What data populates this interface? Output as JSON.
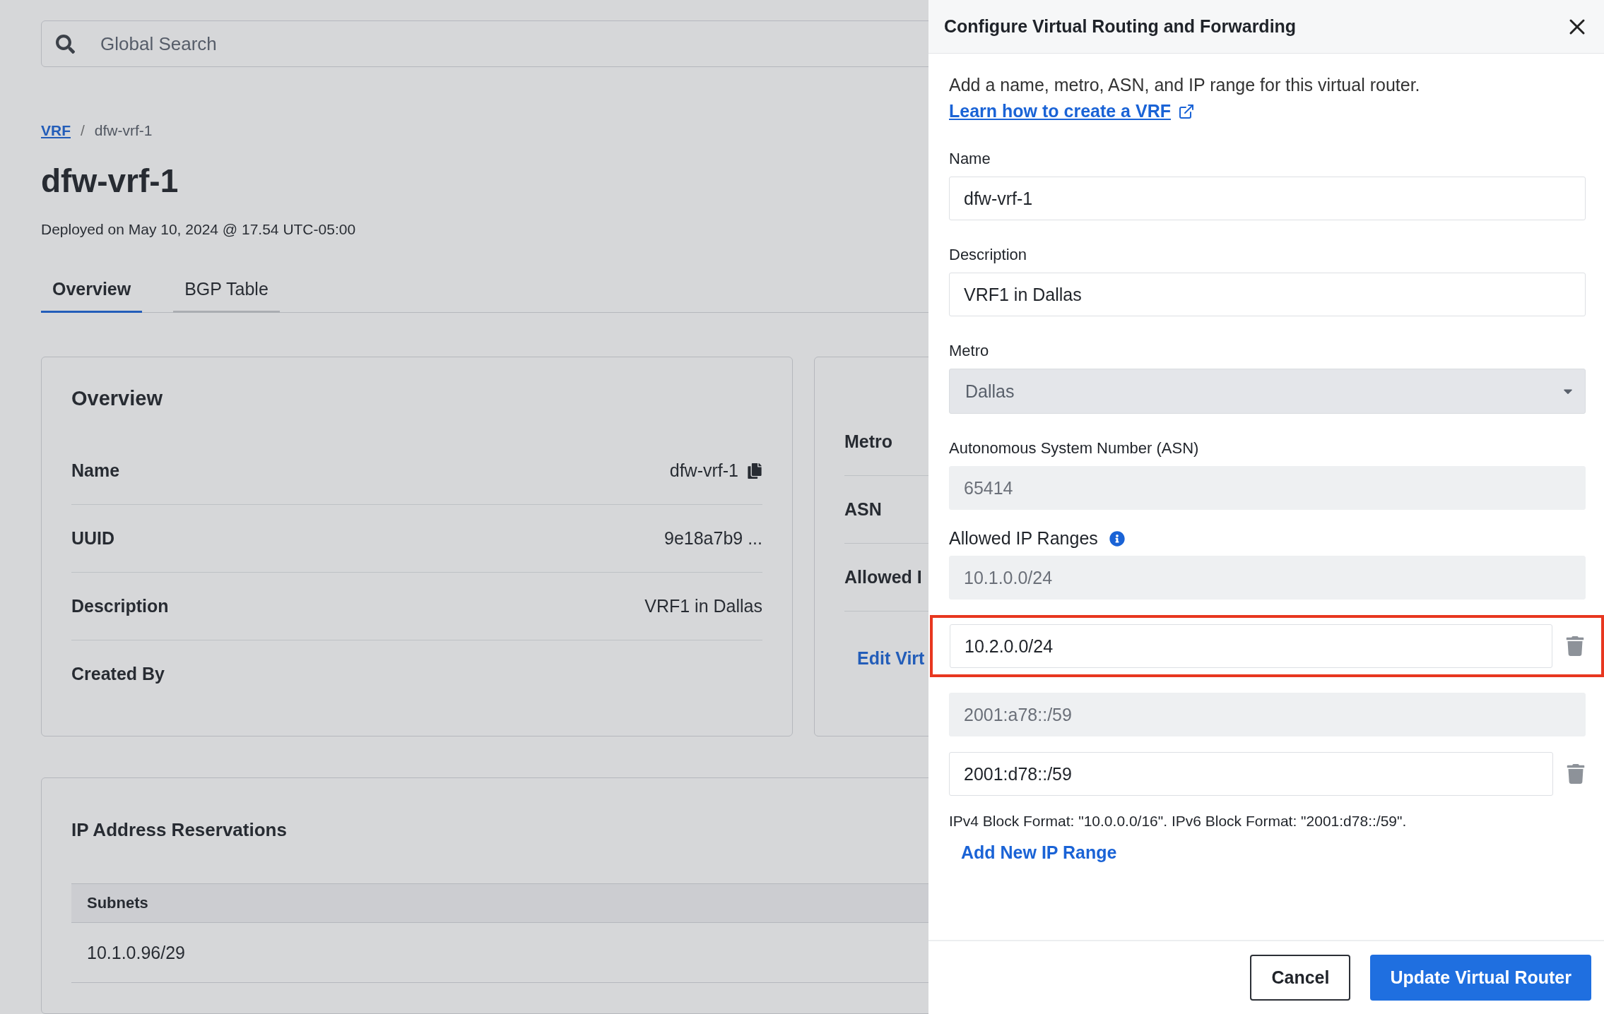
{
  "search": {
    "placeholder": "Global Search"
  },
  "breadcrumb": {
    "items": [
      {
        "label": "VRF",
        "kind": "link"
      },
      {
        "label": "dfw-vrf-1",
        "kind": "current"
      }
    ],
    "separator": "/"
  },
  "page": {
    "title": "dfw-vrf-1",
    "subtitle": "Deployed on May 10, 2024 @ 17.54 UTC-05:00"
  },
  "tabs": [
    {
      "label": "Overview",
      "selected": true
    },
    {
      "label": "BGP Table",
      "selected": false
    }
  ],
  "overview_card": {
    "title": "Overview",
    "rows": [
      {
        "label": "Name",
        "value": "dfw-vrf-1",
        "copy": true
      },
      {
        "label": "UUID",
        "value": "9e18a7b9 ...",
        "copy": false
      },
      {
        "label": "Description",
        "value": "VRF1 in Dallas",
        "copy": false
      },
      {
        "label": "Created By",
        "copy": false
      }
    ]
  },
  "side_card": {
    "rows": [
      "Metro",
      "ASN",
      "Allowed I"
    ],
    "link": "Edit Virt"
  },
  "reservations": {
    "title": "IP Address Reservations",
    "columns": [
      "Subnets"
    ],
    "rows": [
      [
        "10.1.0.96/29"
      ]
    ]
  },
  "drawer": {
    "title": "Configure Virtual Routing and Forwarding",
    "intro": "Add a name, metro, ASN, and IP range for this virtual router.",
    "learn_link": "Learn how to create a VRF",
    "fields": [
      {
        "kind": "text",
        "label": "Name",
        "value": "dfw-vrf-1",
        "disabled": false
      },
      {
        "kind": "text",
        "label": "Description",
        "value": "VRF1 in Dallas",
        "disabled": false
      },
      {
        "kind": "select",
        "label": "Metro",
        "value": "Dallas",
        "disabled": true
      },
      {
        "kind": "text",
        "label": "Autonomous System Number (ASN)",
        "value": "65414",
        "disabled": true
      }
    ],
    "ranges_label": "Allowed IP Ranges",
    "ranges": [
      {
        "value": "10.1.0.0/24",
        "editable": false,
        "highlighted": false
      },
      {
        "value": "10.2.0.0/24",
        "editable": true,
        "highlighted": true
      },
      {
        "value": "2001:a78::/59",
        "editable": false,
        "highlighted": false
      },
      {
        "value": "2001:d78::/59",
        "editable": true,
        "highlighted": false
      }
    ],
    "help": "IPv4 Block Format: \"10.0.0.0/16\". IPv6 Block Format: \"2001:d78::/59\".",
    "add_link": "Add New IP Range",
    "buttons": [
      {
        "label": "Cancel",
        "kind": "secondary"
      },
      {
        "label": "Update Virtual Router",
        "kind": "primary"
      }
    ]
  }
}
